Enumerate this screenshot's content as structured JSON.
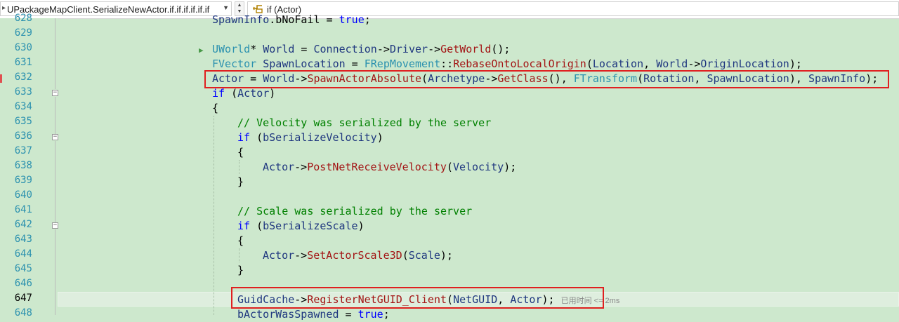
{
  "navbar": {
    "scope_text": "UPackageMapClient.SerializeNewActor.if.if.if.if.if.if",
    "member_text": "if (Actor)"
  },
  "line_numbers": [
    "628",
    "629",
    "630",
    "631",
    "632",
    "633",
    "634",
    "635",
    "636",
    "637",
    "638",
    "639",
    "640",
    "641",
    "642",
    "643",
    "644",
    "645",
    "646",
    "647",
    "648"
  ],
  "code": {
    "l628": [
      "SpawnInfo",
      ".bNoFail = ",
      "true",
      ";"
    ],
    "l630": [
      "UWorld",
      "* ",
      "World",
      " = ",
      "Connection",
      "->",
      "Driver",
      "->",
      "GetWorld",
      "();"
    ],
    "l631": [
      "FVector",
      " ",
      "SpawnLocation",
      " = ",
      "FRepMovement",
      "::",
      "RebaseOntoLocalOrigin",
      "(",
      "Location",
      ", ",
      "World",
      "->",
      "OriginLocation",
      ");"
    ],
    "l632": [
      "Actor",
      " = ",
      "World",
      "->",
      "SpawnActorAbsolute",
      "(",
      "Archetype",
      "->",
      "GetClass",
      "(), ",
      "FTransform",
      "(",
      "Rotation",
      ", ",
      "SpawnLocation",
      "), ",
      "SpawnInfo",
      ");"
    ],
    "l633": [
      "if",
      " (",
      "Actor",
      ")"
    ],
    "l634": "{",
    "l635": "// Velocity was serialized by the server",
    "l636": [
      "if",
      " (",
      "bSerializeVelocity",
      ")"
    ],
    "l637": "{",
    "l638": [
      "Actor",
      "->",
      "PostNetReceiveVelocity",
      "(",
      "Velocity",
      ");"
    ],
    "l639": "}",
    "l641": "// Scale was serialized by the server",
    "l642": [
      "if",
      " (",
      "bSerializeScale",
      ")"
    ],
    "l643": "{",
    "l644": [
      "Actor",
      "->",
      "SetActorScale3D",
      "(",
      "Scale",
      ");"
    ],
    "l645": "}",
    "l647": [
      "GuidCache",
      "->",
      "RegisterNetGUID_Client",
      "(",
      "NetGUID",
      ", ",
      "Actor",
      ");"
    ],
    "l647_hint": "已用时间 <= 2ms",
    "l648": [
      "bActorWasSpawned",
      " = ",
      "true",
      ";"
    ]
  },
  "colors": {
    "background": "#cde8cd",
    "keyword": "#0000ff",
    "type": "#2b91af",
    "function": "#a31515",
    "identifier": "#1f377f",
    "comment": "#008000",
    "highlight_box": "#e02020"
  }
}
